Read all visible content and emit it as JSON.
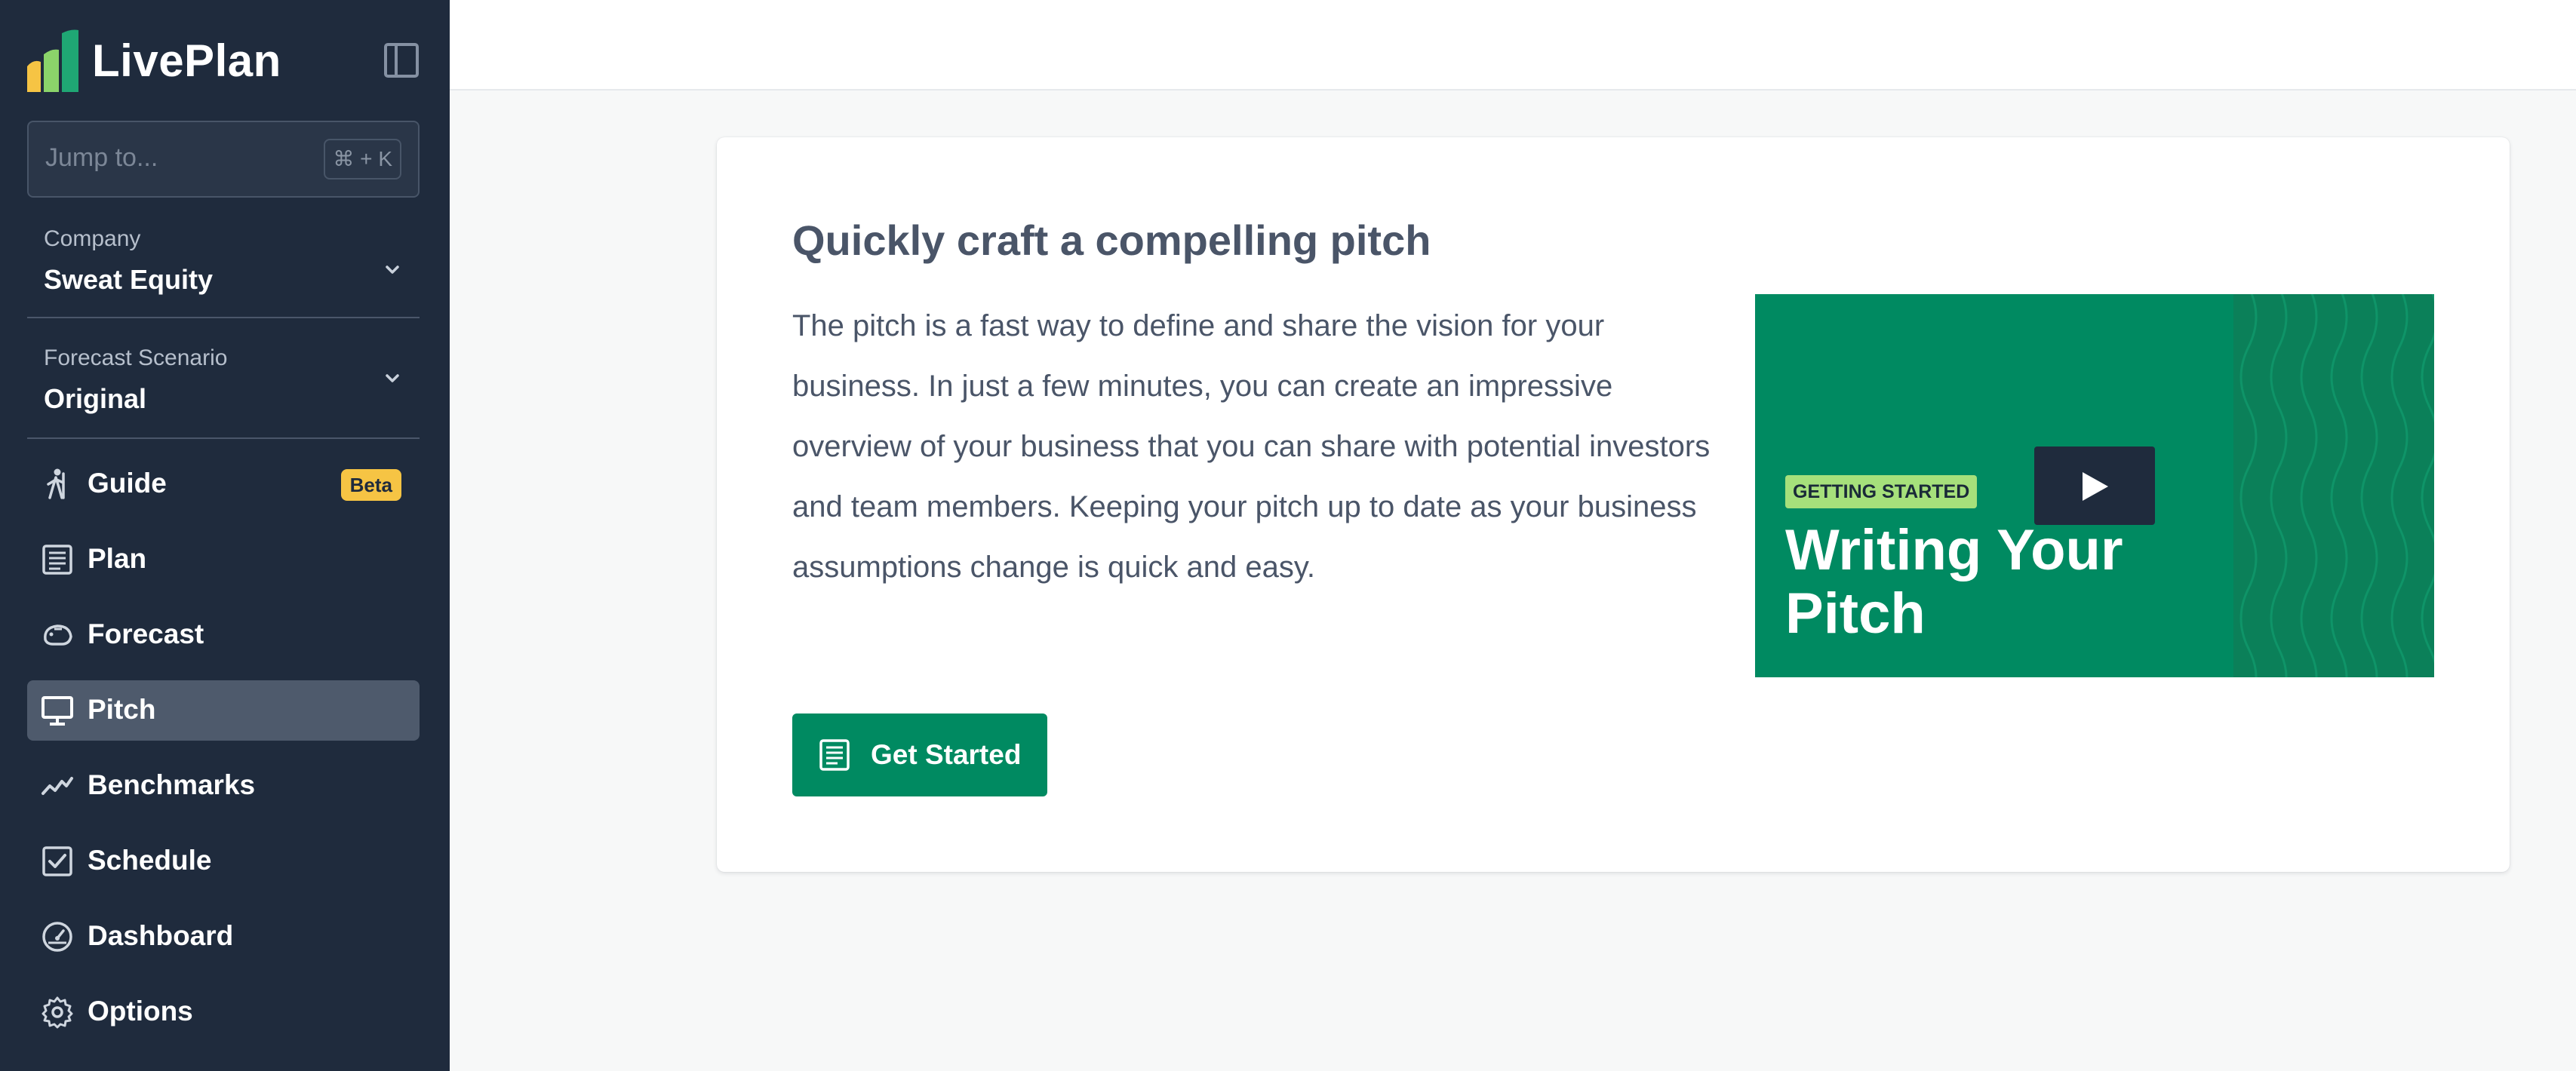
{
  "app": {
    "name": "LivePlan",
    "brand_colors": {
      "sidebar": "#1f2b3d",
      "accent_green": "#008a61",
      "beta_badge": "#f6c444"
    }
  },
  "sidebar": {
    "jump": {
      "placeholder": "Jump to...",
      "shortcut": "⌘ + K"
    },
    "company": {
      "label": "Company",
      "value": "Sweat Equity"
    },
    "scenario": {
      "label": "Forecast Scenario",
      "value": "Original"
    },
    "items": [
      {
        "label": "Guide",
        "icon": "hiker-icon",
        "badge": "Beta"
      },
      {
        "label": "Plan",
        "icon": "document-icon"
      },
      {
        "label": "Forecast",
        "icon": "piggy-bank-icon"
      },
      {
        "label": "Pitch",
        "icon": "monitor-icon",
        "active": true
      },
      {
        "label": "Benchmarks",
        "icon": "trend-line-icon"
      },
      {
        "label": "Schedule",
        "icon": "checkbox-icon"
      },
      {
        "label": "Dashboard",
        "icon": "gauge-icon"
      },
      {
        "label": "Options",
        "icon": "gear-icon"
      }
    ]
  },
  "main": {
    "card": {
      "title": "Quickly craft a compelling pitch",
      "body": "The pitch is a fast way to define and share the vision for your business. In just a few minutes, you can create an impressive overview of your business that you can share with potential investors and team members. Keeping your pitch up to date as your business assumptions change is quick and easy.",
      "cta_label": "Get Started",
      "video": {
        "badge": "GETTING STARTED",
        "title": "Writing Your Pitch"
      }
    }
  }
}
